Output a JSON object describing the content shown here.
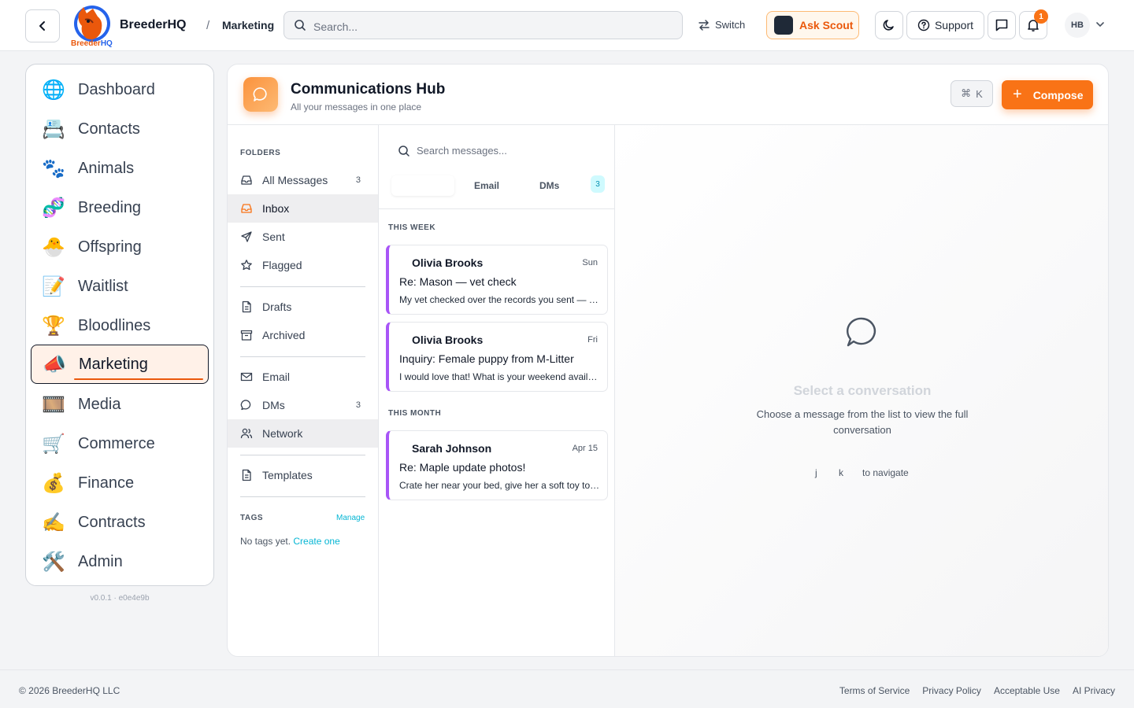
{
  "header": {
    "brand": "BreederHQ",
    "logo_sub_left": "Breeder",
    "logo_sub_right": "HQ",
    "breadcrumb_sep": "/",
    "breadcrumb": "Marketing",
    "search_placeholder": "Search...",
    "switch_label": "Switch",
    "scout_label": "Ask Scout",
    "support_label": "Support",
    "notification_count": "1",
    "avatar_initials": "HB"
  },
  "sidebar": {
    "items": [
      {
        "label": "Dashboard",
        "icon": "🌐"
      },
      {
        "label": "Contacts",
        "icon": "📇"
      },
      {
        "label": "Animals",
        "icon": "🐾"
      },
      {
        "label": "Breeding",
        "icon": "🧬"
      },
      {
        "label": "Offspring",
        "icon": "🐣"
      },
      {
        "label": "Waitlist",
        "icon": "📝"
      },
      {
        "label": "Bloodlines",
        "icon": "🏆"
      },
      {
        "label": "Marketing",
        "icon": "📣"
      },
      {
        "label": "Media",
        "icon": "🎞️"
      },
      {
        "label": "Commerce",
        "icon": "🛒"
      },
      {
        "label": "Finance",
        "icon": "💰"
      },
      {
        "label": "Contracts",
        "icon": "✍️"
      },
      {
        "label": "Admin",
        "icon": "🛠️"
      }
    ],
    "version": "v0.0.1 · e0e4e9b"
  },
  "hub": {
    "title": "Communications Hub",
    "subtitle": "All your messages in one place",
    "shortcut_symbol": "⌘",
    "shortcut_key": "K",
    "compose_plus": "+",
    "compose_label": "Compose"
  },
  "folders": {
    "section_label": "FOLDERS",
    "items": [
      {
        "label": "All Messages",
        "count": "3"
      },
      {
        "label": "Inbox",
        "count": ""
      },
      {
        "label": "Sent",
        "count": ""
      },
      {
        "label": "Flagged",
        "count": ""
      },
      {
        "label": "Drafts",
        "count": ""
      },
      {
        "label": "Archived",
        "count": ""
      },
      {
        "label": "Email",
        "count": ""
      },
      {
        "label": "DMs",
        "count": "3"
      },
      {
        "label": "Network",
        "count": ""
      },
      {
        "label": "Templates",
        "count": ""
      }
    ],
    "tags_label": "TAGS",
    "manage_label": "Manage",
    "no_tags_text": "No tags yet.",
    "create_link": "Create one"
  },
  "list": {
    "search_placeholder": "Search messages...",
    "tabs": [
      {
        "label": "Email"
      },
      {
        "label": "DMs"
      }
    ],
    "dm_badge": "3",
    "groups": [
      {
        "label": "THIS WEEK",
        "messages": [
          {
            "from": "Olivia Brooks",
            "when": "Sun",
            "subject": "Re: Mason — vet check",
            "preview": "My vet checked over the records you sent — all looks good."
          },
          {
            "from": "Olivia Brooks",
            "when": "Fri",
            "subject": "Inquiry: Female puppy from M-Litter",
            "preview": "I would love that! What is your weekend availability?"
          }
        ]
      },
      {
        "label": "THIS MONTH",
        "messages": [
          {
            "from": "Sarah Johnson",
            "when": "Apr 15",
            "subject": "Re: Maple update photos!",
            "preview": "Crate her near your bed, give her a soft toy to cuddle."
          }
        ]
      }
    ]
  },
  "detail": {
    "empty_title": "Select a conversation",
    "empty_subtitle": "Choose a message from the list to view the full conversation",
    "key_j": "j",
    "key_k": "k",
    "nav_hint": "to navigate"
  },
  "footer": {
    "copyright": "© 2026 BreederHQ LLC",
    "links": [
      "Terms of Service",
      "Privacy Policy",
      "Acceptable Use",
      "AI Privacy"
    ]
  },
  "colors": {
    "accent": "#f97316",
    "message_stripe": "#a855f7",
    "link": "#06b6d4"
  }
}
